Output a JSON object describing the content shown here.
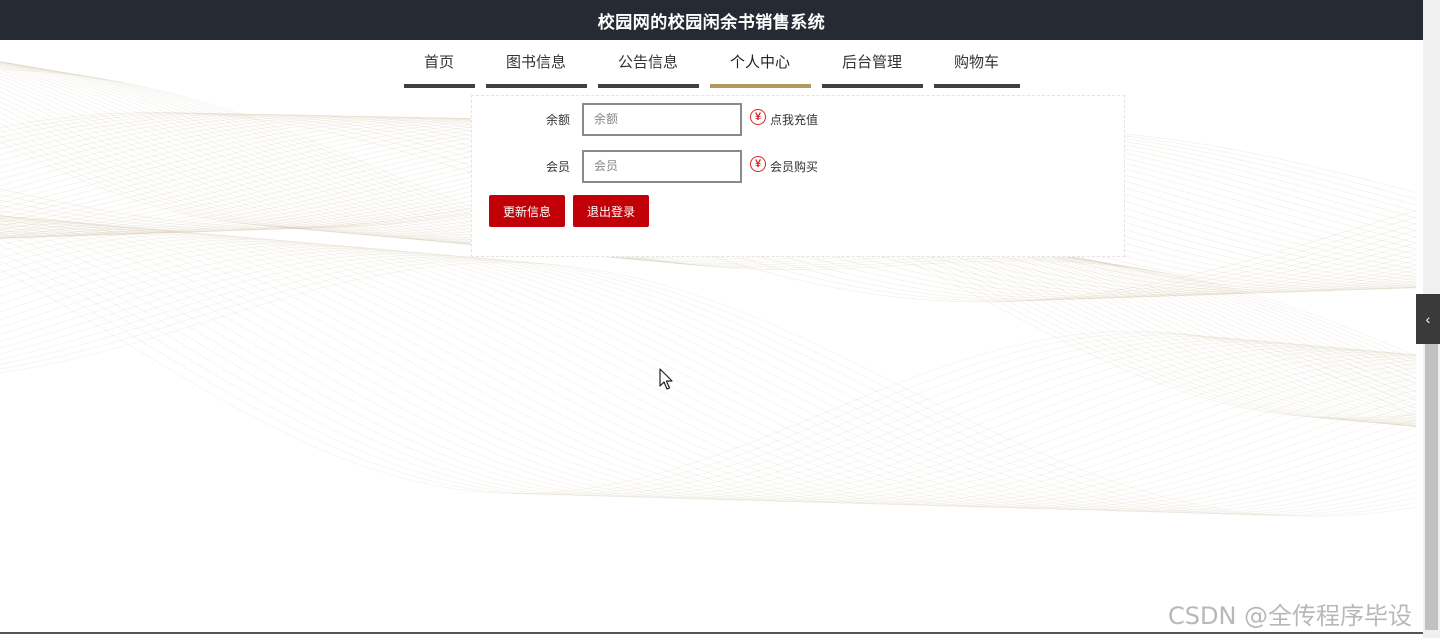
{
  "header": {
    "title": "校园网的校园闲余书销售系统"
  },
  "nav": {
    "items": [
      {
        "label": "首页"
      },
      {
        "label": "图书信息"
      },
      {
        "label": "公告信息"
      },
      {
        "label": "个人中心"
      },
      {
        "label": "后台管理"
      },
      {
        "label": "购物车"
      }
    ],
    "active_label": "个人中心"
  },
  "form": {
    "balance": {
      "label": "余额",
      "placeholder": "余额",
      "value": "",
      "action_label": "点我充值",
      "icon": "yen-icon"
    },
    "member": {
      "label": "会员",
      "placeholder": "会员",
      "value": "",
      "action_label": "会员购买",
      "icon": "yen-icon"
    },
    "update_button": "更新信息",
    "logout_button": "退出登录"
  },
  "side_toggle": {
    "icon": "chevron-left-icon",
    "glyph": "‹"
  },
  "watermark": "CSDN @全传程序毕设",
  "colors": {
    "header_bg": "#252a33",
    "active_underline": "#b09a5e",
    "button_red": "#c10008",
    "icon_red": "#dd2222"
  }
}
